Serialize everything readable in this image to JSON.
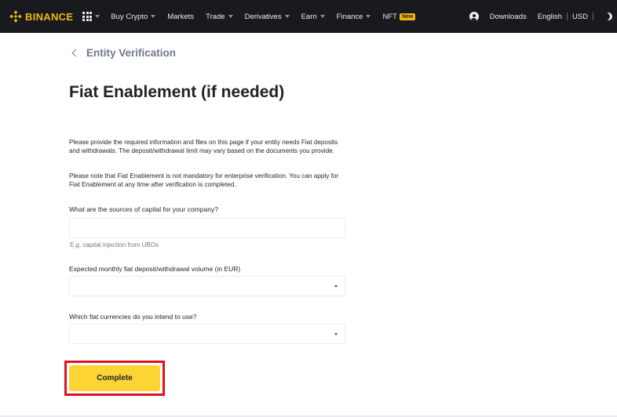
{
  "header": {
    "brand": "BINANCE",
    "brand_color": "#f0b90b",
    "nav": {
      "buy_crypto": "Buy Crypto",
      "markets": "Markets",
      "trade": "Trade",
      "derivatives": "Derivatives",
      "earn": "Earn",
      "finance": "Finance",
      "nft": "NFT",
      "nft_badge": "New"
    },
    "right": {
      "downloads": "Downloads",
      "language": "English",
      "currency": "USD"
    }
  },
  "page": {
    "back_label": "Entity Verification",
    "title": "Fiat Enablement (if needed)",
    "description_1": "Please provide the required information and files on this page if your entity needs Fiat deposits and withdrawals. The deposit/withdrawal limit may vary based on the documents you provide.",
    "description_2": "Please note that Fiat Enablement is not mandatory for enterprise verification. You can apply for Fiat Enablement at any time after verification is completed."
  },
  "form": {
    "capital_sources": {
      "label": "What are the sources of capital for your company?",
      "value": "",
      "hint": "E.g. capital injection from UBOs"
    },
    "monthly_volume": {
      "label": "Expected monthly fiat deposit/withdrawal volume (in EUR)",
      "value": ""
    },
    "currencies": {
      "label": "Which fiat currencies do you intend to use?",
      "value": ""
    },
    "submit_label": "Complete"
  },
  "colors": {
    "accent": "#fcd535",
    "highlight_border": "#e0101f",
    "topbar": "#181a20"
  }
}
